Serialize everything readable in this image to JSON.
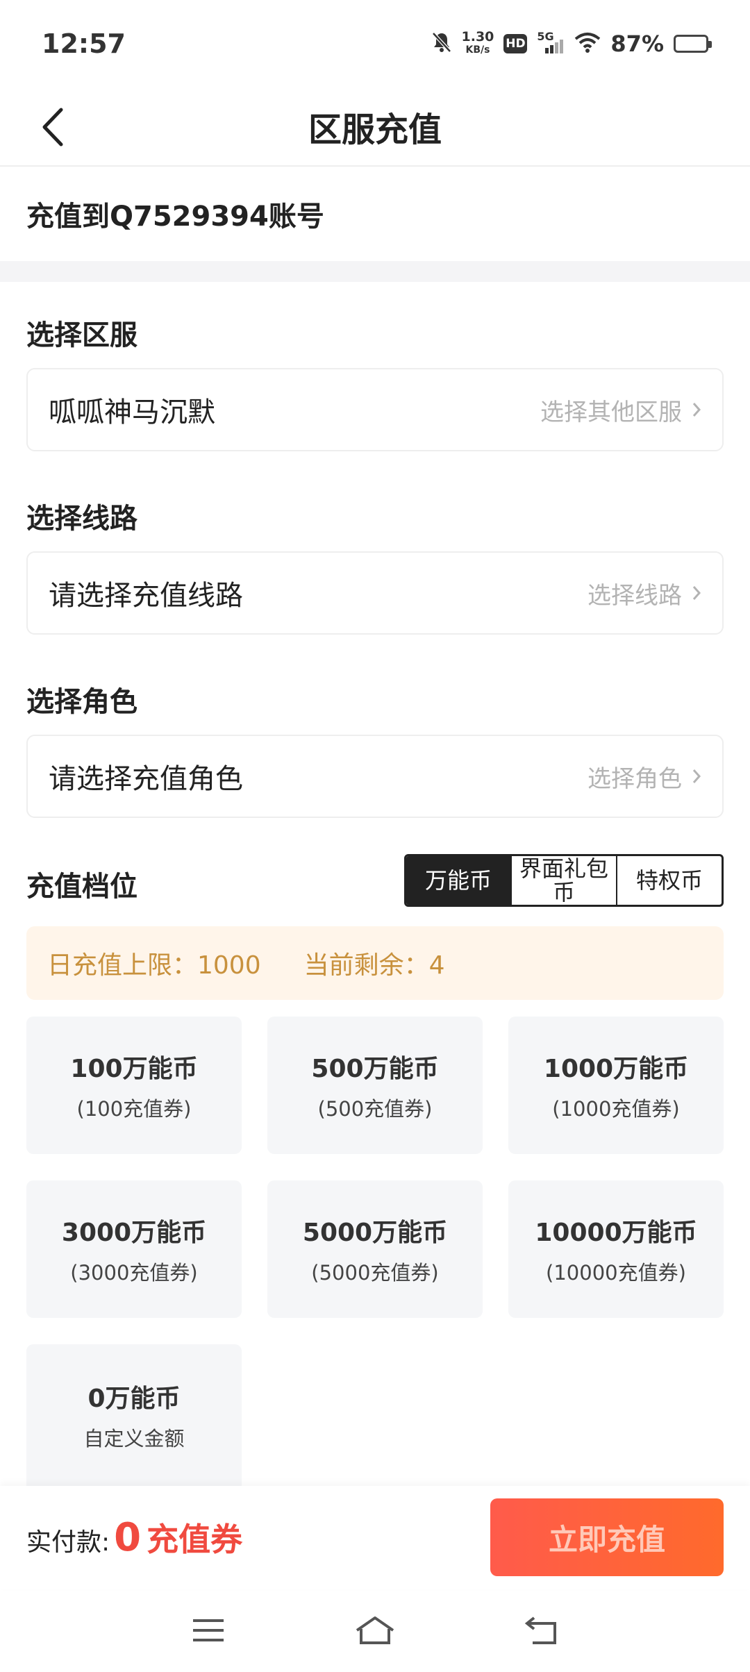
{
  "status_bar": {
    "time": "12:57",
    "speed_value": "1.30",
    "speed_unit": "KB/s",
    "hd": "HD",
    "network": "5G",
    "battery": "87%",
    "battery_level": 0.87,
    "icons": [
      "mute-bell-icon",
      "signal-icon",
      "wifi-icon",
      "battery-icon"
    ]
  },
  "header": {
    "title": "区服充值",
    "back_icon": "back-arrow-icon"
  },
  "account": {
    "text": "充值到Q7529394账号"
  },
  "server": {
    "label": "选择区服",
    "value": "呱呱神马沉默",
    "hint": "选择其他区服"
  },
  "route": {
    "label": "选择线路",
    "value": "请选择充值线路",
    "hint": "选择线路"
  },
  "role": {
    "label": "选择角色",
    "value": "请选择充值角色",
    "hint": "选择角色"
  },
  "tier": {
    "label": "充值档位",
    "tabs": [
      {
        "label": "万能币",
        "active": true
      },
      {
        "label": "界面礼包币",
        "active": false
      },
      {
        "label": "特权币",
        "active": false
      }
    ]
  },
  "limit": {
    "daily": "日充值上限：1000",
    "remaining": "当前剩余：4"
  },
  "options": [
    {
      "title": "100万能币",
      "sub": "(100充值券)"
    },
    {
      "title": "500万能币",
      "sub": "(500充值券)"
    },
    {
      "title": "1000万能币",
      "sub": "(1000充值券)"
    },
    {
      "title": "3000万能币",
      "sub": "(3000充值券)"
    },
    {
      "title": "5000万能币",
      "sub": "(5000充值券)"
    },
    {
      "title": "10000万能币",
      "sub": "(10000充值券)"
    },
    {
      "title": "0万能币",
      "sub": "自定义金额"
    }
  ],
  "pay": {
    "label": "实付款:",
    "amount": "0",
    "unit": "充值券",
    "button": "立即充值"
  },
  "colors": {
    "accent_red": "#f04a3f",
    "button_gradient_start": "#ff5b4b",
    "button_gradient_end": "#ff6a2c",
    "limit_text": "#c8913d",
    "limit_bg": "#fff5ea"
  },
  "nav_bar": {
    "icons": [
      "menu-icon",
      "home-icon",
      "back-icon"
    ]
  }
}
